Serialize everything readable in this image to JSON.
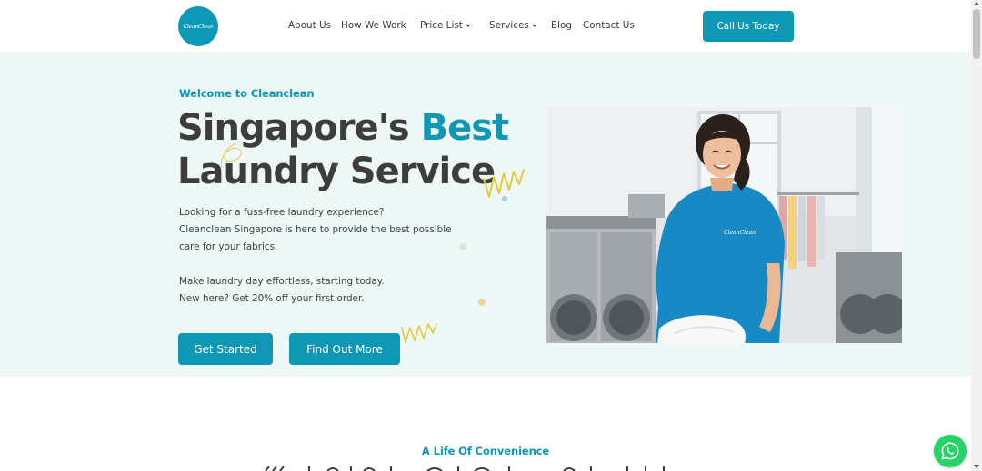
{
  "header": {
    "logo_text": "CleanClean",
    "nav": [
      {
        "label": "About Us"
      },
      {
        "label": "How We Work"
      },
      {
        "label": "Price List"
      },
      {
        "label": "Services"
      },
      {
        "label": "Blog"
      },
      {
        "label": "Contact Us"
      }
    ],
    "cta_label": "Call Us Today"
  },
  "hero": {
    "welcome": "Welcome to Cleanclean",
    "headline_part1": "Singapore's ",
    "headline_accent": "Best",
    "headline_line2": "Laundry Service",
    "desc_lines": [
      "Looking for a fuss-free laundry experience?",
      "Cleanclean Singapore is here to provide the best possible",
      "care for your fabrics.",
      "Make laundry day effortless, starting today.",
      "New here? Get 20% off your first order."
    ],
    "btn_start": "Get Started",
    "btn_more": "Find Out More",
    "photo_shirt_text": "CleanClean"
  },
  "section2": {
    "eyebrow": "A Life Of Convenience"
  },
  "colors": {
    "brand": "#0f98b5",
    "hero_bg": "#eef8f6",
    "text": "#3d3d3d",
    "whatsapp": "#25d366"
  },
  "icons": [
    "chevron-down-icon",
    "whatsapp-icon"
  ]
}
